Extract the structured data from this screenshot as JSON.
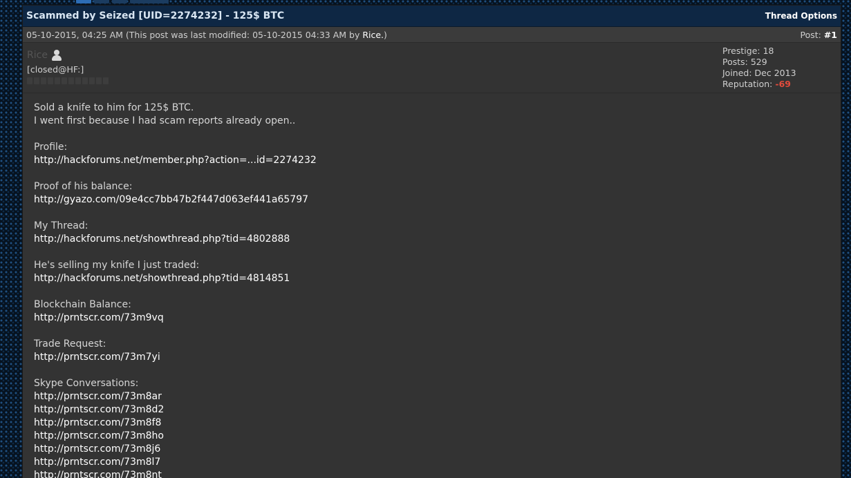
{
  "thread": {
    "title": "Scammed by Seized [UID=2274232] - 125$ BTC",
    "options_label": "Thread Options"
  },
  "post": {
    "timestamp": "05-10-2015, 04:25 AM",
    "modified_prefix": "(This post was last modified: 05-10-2015 04:33 AM by ",
    "modified_by": "Rice.",
    "modified_suffix": ")",
    "post_label": "Post: ",
    "post_number": "#1"
  },
  "author": {
    "username": "Rice",
    "usertitle": "[closed@HF:]",
    "stats": {
      "prestige_label": "Prestige: ",
      "prestige": "18",
      "posts_label": "Posts: ",
      "posts": "529",
      "joined_label": "Joined: ",
      "joined": "Dec 2013",
      "reputation_label": "Reputation: ",
      "reputation": "-69"
    }
  },
  "colors": {
    "header_bg": "#0e2744",
    "post_bg": "#333333",
    "reputation_negative": "#e24b3c"
  },
  "body": {
    "lines": [
      {
        "text": "Sold a knife to him for 125$ BTC.",
        "link": false
      },
      {
        "text": "I went first because I had scam reports already open..",
        "link": false
      },
      {
        "text": "",
        "link": false
      },
      {
        "text": "Profile:",
        "link": false
      },
      {
        "text": "http://hackforums.net/member.php?action=...id=2274232",
        "link": true
      },
      {
        "text": "",
        "link": false
      },
      {
        "text": "Proof of his balance:",
        "link": false
      },
      {
        "text": "http://gyazo.com/09e4cc7bb47b2f447d063ef441a65797",
        "link": true
      },
      {
        "text": "",
        "link": false
      },
      {
        "text": "My Thread:",
        "link": false
      },
      {
        "text": "http://hackforums.net/showthread.php?tid=4802888",
        "link": true
      },
      {
        "text": "",
        "link": false
      },
      {
        "text": "He's selling my knife I just traded:",
        "link": false
      },
      {
        "text": "http://hackforums.net/showthread.php?tid=4814851",
        "link": true
      },
      {
        "text": "",
        "link": false
      },
      {
        "text": "Blockchain Balance:",
        "link": false
      },
      {
        "text": "http://prntscr.com/73m9vq",
        "link": true
      },
      {
        "text": "",
        "link": false
      },
      {
        "text": "Trade Request:",
        "link": false
      },
      {
        "text": "http://prntscr.com/73m7yi",
        "link": true
      },
      {
        "text": "",
        "link": false
      },
      {
        "text": "Skype Conversations:",
        "link": false
      },
      {
        "text": "http://prntscr.com/73m8ar",
        "link": true
      },
      {
        "text": "http://prntscr.com/73m8d2",
        "link": true
      },
      {
        "text": "http://prntscr.com/73m8f8",
        "link": true
      },
      {
        "text": "http://prntscr.com/73m8ho",
        "link": true
      },
      {
        "text": "http://prntscr.com/73m8j6",
        "link": true
      },
      {
        "text": "http://prntscr.com/73m8l7",
        "link": true
      },
      {
        "text": "http://prntscr.com/73m8nt",
        "link": true
      }
    ]
  }
}
